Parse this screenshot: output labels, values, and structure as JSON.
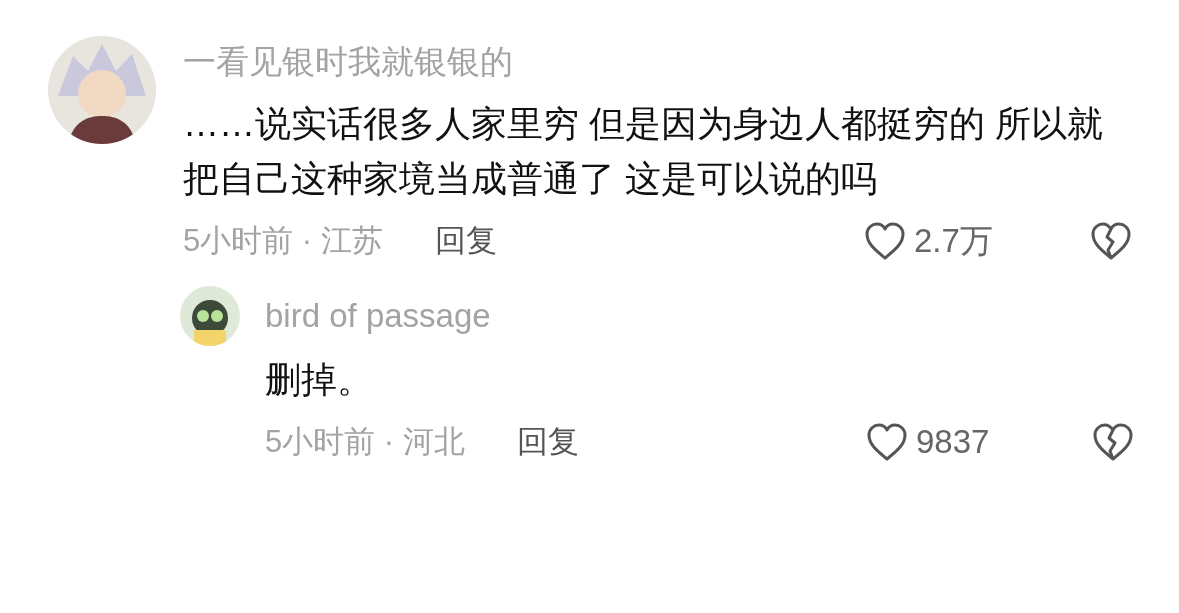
{
  "comments": [
    {
      "username": "一看见银时我就银银的",
      "text": "……说实话很多人家里穷 但是因为身边人都挺穷的 所以就把自己这种家境当成普通了 这是可以说的吗",
      "meta": "5小时前 · 江苏",
      "reply": "回复",
      "likes": "2.7万",
      "replies": [
        {
          "username": "bird of passage",
          "text": "删掉。",
          "meta": "5小时前 · 河北",
          "reply": "回复",
          "likes": "9837"
        }
      ]
    }
  ]
}
